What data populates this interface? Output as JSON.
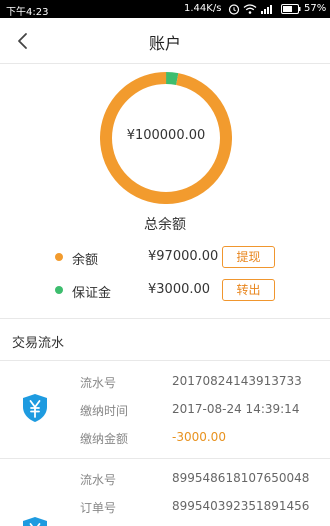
{
  "status_bar": {
    "time": "下午4:23",
    "net_speed": "1.44K/s",
    "battery": "57%"
  },
  "nav": {
    "title": "账户"
  },
  "summary": {
    "total_amount": "¥100000.00",
    "total_label": "总余额",
    "ring_colors": {
      "balance": "#f29b2e",
      "deposit": "#3dbd6e"
    },
    "share": {
      "balance": 0.97,
      "deposit": 0.03
    },
    "items": [
      {
        "label": "余额",
        "amount": "¥97000.00",
        "button": "提现",
        "color": "#f29b2e"
      },
      {
        "label": "保证金",
        "amount": "¥3000.00",
        "button": "转出",
        "color": "#3dbd6e"
      }
    ]
  },
  "transactions": {
    "title": "交易流水",
    "records": [
      {
        "icon": "shield-yen-icon",
        "rows": [
          {
            "key": "流水号",
            "value": "20170824143913733"
          },
          {
            "key": "缴纳时间",
            "value": "2017-08-24 14:39:14"
          },
          {
            "key": "缴纳金额",
            "value": "-3000.00"
          }
        ]
      },
      {
        "icon": "shield-yen-icon",
        "rows": [
          {
            "key": "流水号",
            "value": "899548618107650048"
          },
          {
            "key": "订单号",
            "value": "899540392351891456"
          }
        ]
      }
    ]
  }
}
